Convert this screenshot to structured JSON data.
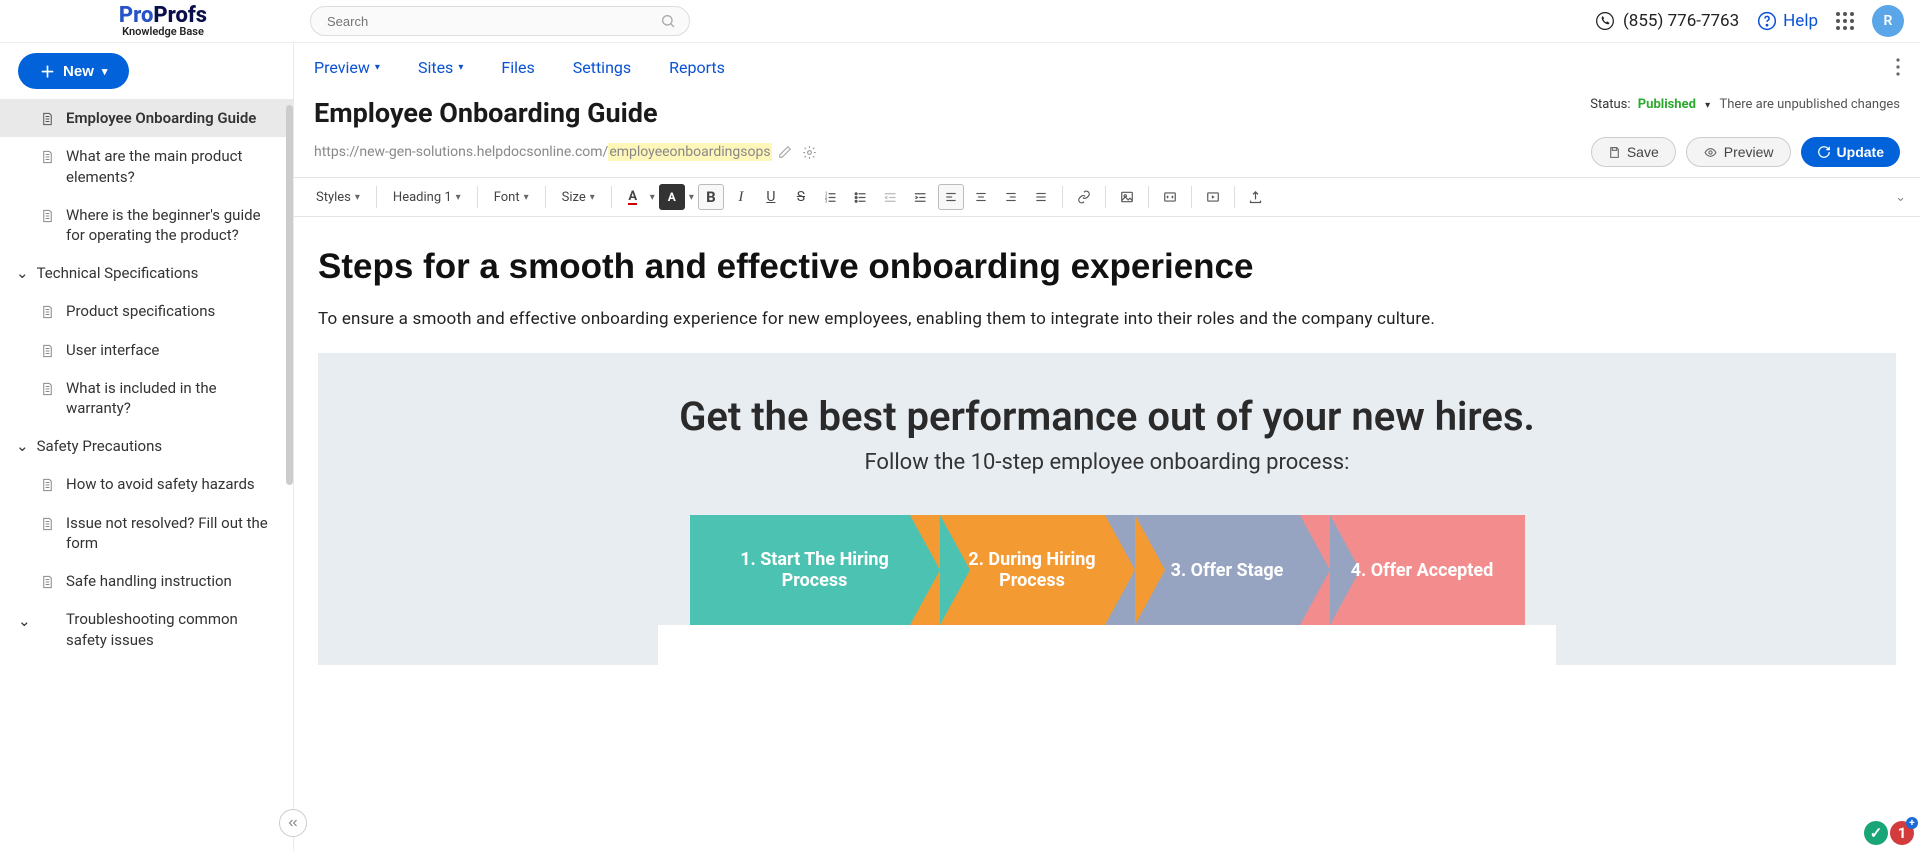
{
  "header": {
    "logo_main1": "Pro",
    "logo_main2": "Profs",
    "logo_sub": "Knowledge Base",
    "search_placeholder": "Search",
    "phone": "(855) 776-7763",
    "help": "Help",
    "avatar_initial": "R"
  },
  "new_button": {
    "label": "New"
  },
  "sidebar": {
    "items": [
      {
        "label": "Employee Onboarding Guide",
        "active": true
      },
      {
        "label": "What are the main product elements?"
      },
      {
        "label": "Where is the beginner's guide for operating the product?"
      }
    ],
    "sections": [
      {
        "title": "Technical Specifications",
        "items": [
          {
            "label": "Product specifications"
          },
          {
            "label": "User interface"
          },
          {
            "label": "What is included in the warranty?"
          }
        ]
      },
      {
        "title": "Safety Precautions",
        "items": [
          {
            "label": "How to avoid safety hazards"
          },
          {
            "label": "Issue not resolved? Fill out the form"
          },
          {
            "label": "Safe handling instruction"
          },
          {
            "label": "Troubleshooting common safety issues"
          }
        ]
      }
    ]
  },
  "submenu": {
    "preview": "Preview",
    "sites": "Sites",
    "files": "Files",
    "settings": "Settings",
    "reports": "Reports"
  },
  "page": {
    "title": "Employee Onboarding Guide",
    "url_prefix": "https://new-gen-solutions.helpdocsonline.com/",
    "url_slug": "employeeonboardingsops",
    "status_label": "Status:",
    "status_value": "Published",
    "unpublished_msg": "There are unpublished changes"
  },
  "actions": {
    "save": "Save",
    "preview": "Preview",
    "update": "Update"
  },
  "toolbar": {
    "styles": "Styles",
    "heading": "Heading 1",
    "font": "Font",
    "size": "Size"
  },
  "content": {
    "h1": "Steps for a smooth and effective onboarding experience",
    "p": "To ensure a smooth and effective onboarding experience for new employees, enabling them to integrate into their roles and the company culture.",
    "hero_h": "Get the best performance out of your new hires.",
    "hero_sub": "Follow the 10-step employee onboarding process:",
    "steps": [
      "1. Start The Hiring Process",
      "2. During Hiring Process",
      "3. Offer Stage",
      "4. Offer Accepted"
    ]
  },
  "badges": {
    "g": "✓",
    "r": "1"
  }
}
